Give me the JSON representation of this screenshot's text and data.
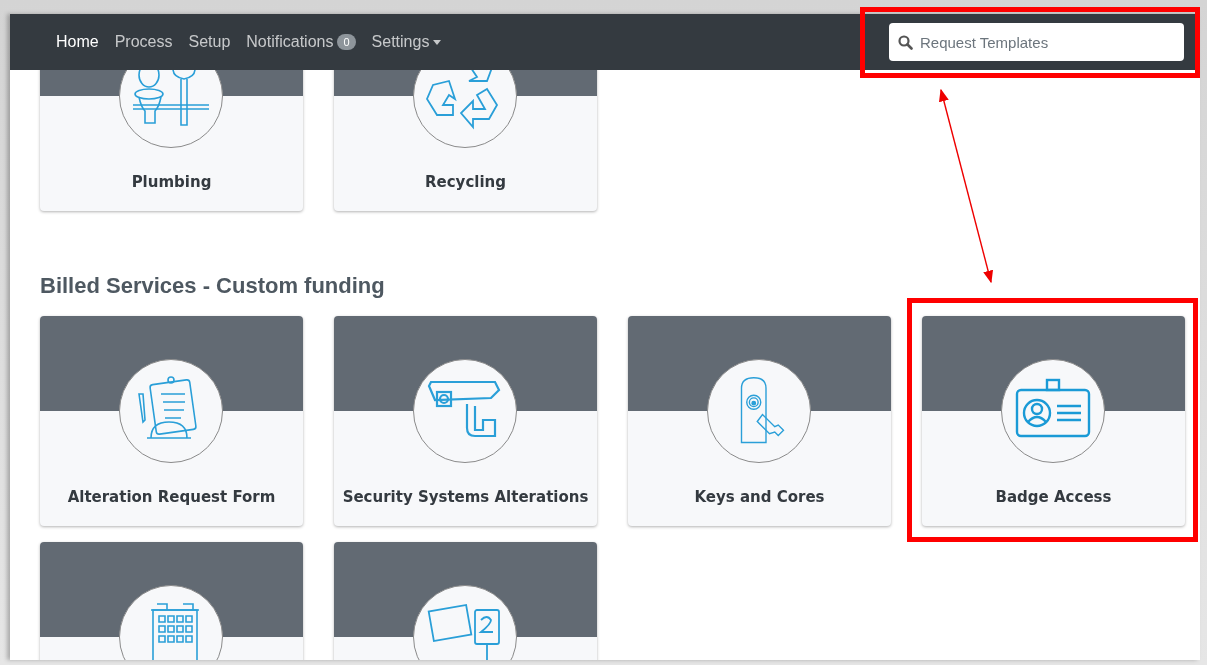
{
  "navbar": {
    "items": [
      {
        "label": "Home",
        "selected": true
      },
      {
        "label": "Process",
        "selected": false
      },
      {
        "label": "Setup",
        "selected": false
      },
      {
        "label": "Notifications",
        "selected": false,
        "badge": "0"
      },
      {
        "label": "Settings",
        "selected": false,
        "dropdown": true
      }
    ],
    "search": {
      "placeholder": "Request Templates",
      "highlighted": true
    }
  },
  "sections": [
    {
      "cards": [
        {
          "label": "Plumbing",
          "kind": "plumbing",
          "highlighted": false
        },
        {
          "label": "Recycling",
          "kind": "recycling",
          "highlighted": false
        }
      ]
    },
    {
      "heading": "Billed Services - Custom funding",
      "cards": [
        {
          "label": "Alteration Request Form",
          "kind": "clipboard",
          "highlighted": false
        },
        {
          "label": "Security Systems Alterations",
          "kind": "camera",
          "highlighted": false
        },
        {
          "label": "Keys and Cores",
          "kind": "keys",
          "highlighted": false
        },
        {
          "label": "Badge Access",
          "kind": "badge",
          "highlighted": true
        },
        {
          "kind": "building",
          "highlighted": false
        },
        {
          "kind": "sign",
          "highlighted": false
        }
      ]
    }
  ]
}
